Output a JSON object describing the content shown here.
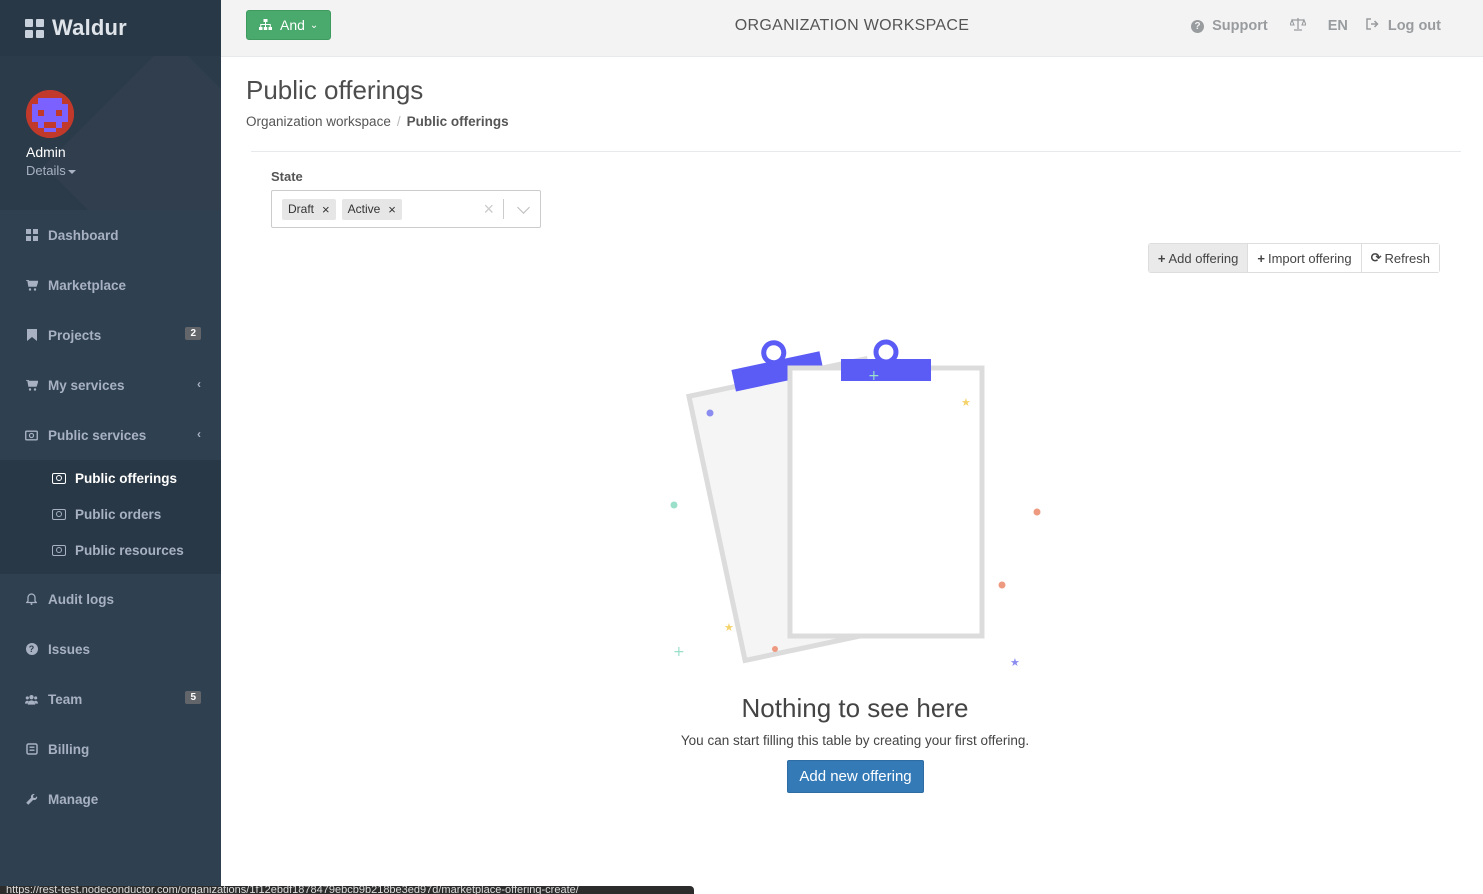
{
  "brand": {
    "name": "Waldur"
  },
  "profile": {
    "name": "Admin",
    "details_label": "Details"
  },
  "sidebar": {
    "items": [
      {
        "label": "Dashboard",
        "icon": "dashboard-icon"
      },
      {
        "label": "Marketplace",
        "icon": "cart-icon"
      },
      {
        "label": "Projects",
        "icon": "bookmark-icon",
        "badge": "2"
      },
      {
        "label": "My services",
        "icon": "cart-icon"
      },
      {
        "label": "Public services",
        "icon": "money-icon"
      },
      {
        "label": "Audit logs",
        "icon": "bell-icon"
      },
      {
        "label": "Issues",
        "icon": "question-icon"
      },
      {
        "label": "Team",
        "icon": "users-icon",
        "badge": "5"
      },
      {
        "label": "Billing",
        "icon": "billing-icon"
      },
      {
        "label": "Manage",
        "icon": "wrench-icon"
      }
    ],
    "public_services_sub": [
      {
        "label": "Public offerings",
        "active": true
      },
      {
        "label": "Public orders"
      },
      {
        "label": "Public resources"
      }
    ]
  },
  "topbar": {
    "and_label": "And",
    "workspace_title": "ORGANIZATION WORKSPACE",
    "support_label": "Support",
    "lang_label": "EN",
    "logout_label": "Log out"
  },
  "page": {
    "title": "Public offerings",
    "breadcrumb": {
      "parent": "Organization workspace",
      "separator": "/",
      "current": "Public offerings"
    }
  },
  "filter": {
    "state_label": "State",
    "selected": [
      "Draft",
      "Active"
    ]
  },
  "actions": {
    "add_offering": "Add offering",
    "import_offering": "Import offering",
    "refresh": "Refresh"
  },
  "empty_state": {
    "title": "Nothing to see here",
    "subtitle": "You can start filling this table by creating your first offering.",
    "button": "Add new offering"
  },
  "status_bar": {
    "url": "https://rest-test.nodeconductor.com/organizations/1f12ebdf1878479ebcb9b218be3ed97d/marketplace-offering-create/"
  },
  "colors": {
    "sidebar_bg": "#2f4050",
    "accent_green": "#4aa96c",
    "primary_blue": "#337ab7",
    "illustration_purple": "#5b5bf5"
  }
}
